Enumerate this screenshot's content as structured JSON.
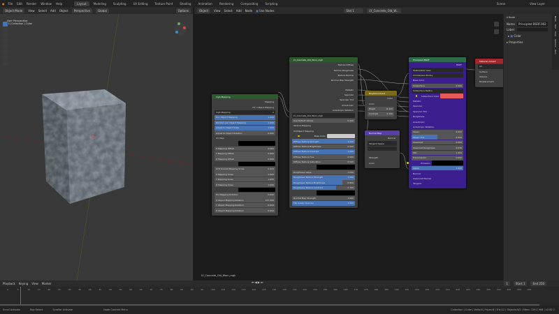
{
  "menu": {
    "items": [
      "File",
      "Edit",
      "Render",
      "Window",
      "Help"
    ],
    "workspaces": [
      "Layout",
      "Modeling",
      "Sculpting",
      "UV Editing",
      "Texture Paint",
      "Shading",
      "Animation",
      "Rendering",
      "Compositing",
      "Scripting"
    ],
    "active": "Layout",
    "scene": "Scene",
    "view_layer": "View Layer"
  },
  "viewport_header": {
    "orientation": "Global",
    "mode": "Object Mode",
    "menus": [
      "View",
      "Select",
      "Add",
      "Object"
    ],
    "pivot": "Perspective",
    "options": "Options"
  },
  "viewport": {
    "line1": "User Perspective",
    "line2": "(1) Collection | Cube"
  },
  "node_header": {
    "editor": "Object",
    "menus": [
      "View",
      "Select",
      "Add",
      "Node"
    ],
    "use_nodes": "Use Nodes",
    "slot": "Slot 1",
    "material": "LY_Concrete_Old_W..."
  },
  "frame_label": "LY_Concrete_Old_Worn_mgh",
  "colors": {
    "accent": "#4772b3",
    "principled": "#3b1f8f",
    "output_header": "#a3262d",
    "bc_header": "#7a6a1b",
    "nm_header": "#5a3ea8"
  },
  "nodes": {
    "mapping": {
      "title": "mgh-Mapping",
      "rows": [
        {
          "t": "out",
          "l": "Mapping"
        },
        {
          "t": "out",
          "l": "UV / Object Mapping"
        },
        {
          "t": "sel",
          "l": "mgh-Mapping",
          "v": "2"
        },
        {
          "t": "blue",
          "l": "UV / Object Mapping",
          "v": "1.000"
        },
        {
          "t": "blue",
          "l": "Random per Object Mapping",
          "v": "1.000"
        },
        {
          "t": "blue",
          "l": "Adjust to Object Scale",
          "v": "1.000"
        },
        {
          "t": "field",
          "l": "Adjust to Object Rotation",
          "v": "0.000"
        },
        {
          "t": "in",
          "l": "UV Map"
        },
        {
          "t": "black"
        },
        {
          "t": "field",
          "l": "X Mapping Offset",
          "v": "0.000"
        },
        {
          "t": "field",
          "l": "Y Mapping Offset",
          "v": "0.000"
        },
        {
          "t": "field",
          "l": "Z Mapping Offset",
          "v": "0.000"
        },
        {
          "t": "black"
        },
        {
          "t": "field",
          "l": "XYZ Overall Mapping Scale",
          "v": "0.444"
        },
        {
          "t": "field",
          "l": "X Mapping Scale",
          "v": "1.000"
        },
        {
          "t": "field",
          "l": "Y Mapping Scale",
          "v": "1.000"
        },
        {
          "t": "field",
          "l": "Z Mapping Scale",
          "v": "1.000"
        },
        {
          "t": "black"
        },
        {
          "t": "field",
          "l": "UV Mapping Rotation",
          "v": "0.000"
        },
        {
          "t": "field",
          "l": "X Object Mapping Rotation",
          "v": "127.200"
        },
        {
          "t": "field",
          "l": "Y Object Mapping Rotation",
          "v": "0.000"
        },
        {
          "t": "field",
          "l": "Z Object Mapping Rotation",
          "v": "0.000"
        }
      ]
    },
    "texture": {
      "title": "LY_Concrete_Old_Worn_mgh",
      "rows": [
        {
          "t": "out",
          "l": "Texture Diffuse"
        },
        {
          "t": "out",
          "l": "Texture Roughness"
        },
        {
          "t": "out",
          "l": "Texture Normal"
        },
        {
          "t": "out",
          "l": "Normal Map Strength"
        },
        {
          "t": "gap"
        },
        {
          "t": "out",
          "l": "Metallic"
        },
        {
          "t": "out",
          "l": "Specular"
        },
        {
          "t": "out",
          "l": "Specular Tint"
        },
        {
          "t": "out",
          "l": "Anisotropic"
        },
        {
          "t": "out",
          "l": "Anisotropic Rotation"
        },
        {
          "t": "sel",
          "l": "LY_Concrete_Old_Worn_mgh"
        },
        {
          "t": "field",
          "l": "Use Default Values",
          "v": "0.000"
        },
        {
          "t": "in",
          "l": "Texture Mapping"
        },
        {
          "t": "in",
          "l": "UV/Object Mapping"
        },
        {
          "t": "color",
          "l": "Base Color"
        },
        {
          "t": "blue",
          "l": "Diffuse Texture Strength",
          "v": "1.000"
        },
        {
          "t": "field",
          "l": "Diffuse Texture Brightness",
          "v": "0.500"
        },
        {
          "t": "blue",
          "l": "Diffuse Texture Contrast",
          "v": "1.000"
        },
        {
          "t": "field",
          "l": "Diffuse Texture Hue",
          "v": "0.500"
        },
        {
          "t": "field",
          "l": "Diffuse Texture Saturation",
          "v": "0.500"
        },
        {
          "t": "black"
        },
        {
          "t": "field",
          "l": "Roughness Value",
          "v": "1.000"
        },
        {
          "t": "blue",
          "l": "Roughness Texture Strength",
          "v": "1.000"
        },
        {
          "t": "blue",
          "l": "Roughness Texture Brightness",
          "v": "0.800"
        },
        {
          "t": "blue",
          "l": "Roughness Texture Contrast",
          "v": "0.700"
        },
        {
          "t": "black"
        },
        {
          "t": "field",
          "l": "Normal Map Strength",
          "v": "1.000"
        },
        {
          "t": "blue",
          "l": "Flip Green Channel",
          "v": "1.000"
        }
      ]
    },
    "bright": {
      "title": "Bright/Contrast",
      "rows": [
        {
          "t": "out",
          "l": "Color"
        },
        {
          "t": "in",
          "l": "Color"
        },
        {
          "t": "field",
          "l": "Bright",
          "v": "-0.100"
        },
        {
          "t": "field",
          "l": "Contrast",
          "v": "0.100"
        }
      ]
    },
    "normalmap": {
      "title": "Normal Map",
      "rows": [
        {
          "t": "out",
          "l": "Normal"
        },
        {
          "t": "sel",
          "l": "Tangent Space"
        },
        {
          "t": "sel",
          "l": "-"
        },
        {
          "t": "gap"
        },
        {
          "t": "in",
          "l": "Strength"
        },
        {
          "t": "in",
          "l": "Color"
        }
      ]
    },
    "principled": {
      "title": "Principled BSDF",
      "rows": [
        {
          "t": "out",
          "l": "BSDF"
        },
        {
          "t": "sel",
          "l": "Multiscatter GGX"
        },
        {
          "t": "sel",
          "l": "Christensen-Burley"
        },
        {
          "t": "in",
          "l": "Base Color"
        },
        {
          "t": "field",
          "l": "Subsurface",
          "v": "0.000"
        },
        {
          "t": "sel",
          "l": "Subsurface Radius"
        },
        {
          "t": "red",
          "l": "Subsurface Color"
        },
        {
          "t": "in",
          "l": "Metallic"
        },
        {
          "t": "in",
          "l": "Specular"
        },
        {
          "t": "in",
          "l": "Specular Tint"
        },
        {
          "t": "in",
          "l": "Roughness"
        },
        {
          "t": "in",
          "l": "Anisotropic"
        },
        {
          "t": "in",
          "l": "Anisotropic Rotation"
        },
        {
          "t": "field",
          "l": "Sheen",
          "v": "0.000"
        },
        {
          "t": "blue",
          "l": "Sheen Tint",
          "v": "0.500"
        },
        {
          "t": "field",
          "l": "Clearcoat",
          "v": "0.000"
        },
        {
          "t": "field",
          "l": "Clearcoat Roughness",
          "v": "0.030"
        },
        {
          "t": "field",
          "l": "IOR",
          "v": "1.450"
        },
        {
          "t": "field",
          "l": "Transmission",
          "v": "0.000"
        },
        {
          "t": "black",
          "l": "Emission"
        },
        {
          "t": "blue",
          "l": "Alpha",
          "v": "1.000"
        },
        {
          "t": "in",
          "l": "Normal"
        },
        {
          "t": "in",
          "l": "Clearcoat Normal"
        },
        {
          "t": "in",
          "l": "Tangent"
        }
      ]
    },
    "output": {
      "title": "Material Output",
      "rows": [
        {
          "t": "sel",
          "l": "All"
        },
        {
          "t": "in",
          "l": "Surface"
        },
        {
          "t": "in",
          "l": "Volume"
        },
        {
          "t": "in",
          "l": "Displacement"
        }
      ]
    }
  },
  "sidebar": {
    "section": "Node",
    "name_label": "Name",
    "name_value": "Principled BSDF.002",
    "label_label": "Label",
    "color_label": "Color",
    "properties": "Properties",
    "tabs": [
      "Node",
      "Tool",
      "View",
      "Options",
      "Item"
    ]
  },
  "timeline": {
    "menus": [
      "Playback",
      "Keying",
      "View",
      "Marker"
    ],
    "current_frame": "1",
    "start_label": "Start",
    "start": "1",
    "end_label": "End",
    "end": "250",
    "ticks": [
      "0",
      "5",
      "10",
      "15",
      "20",
      "25",
      "30",
      "35",
      "40",
      "45",
      "50",
      "55",
      "60",
      "65",
      "70",
      "75",
      "80",
      "85",
      "90",
      "95",
      "100",
      "105",
      "110",
      "115",
      "120",
      "125",
      "130",
      "135",
      "140",
      "145",
      "150",
      "155",
      "160",
      "165",
      "170",
      "175",
      "180",
      "185",
      "190",
      "195",
      "200",
      "205",
      "210",
      "215",
      "220",
      "225",
      "230",
      "235",
      "240",
      "245",
      "250",
      "255"
    ]
  },
  "status": {
    "items": [
      "Scroll Activate",
      "Box Select",
      "Scroller Activate",
      "Node Context Menu"
    ],
    "stats": "Collection | Cube | Verts:8 | Faces:6 | Tris:12 | Objects:0/2 | Mem: 129.1 MiB | v2.82.7"
  }
}
